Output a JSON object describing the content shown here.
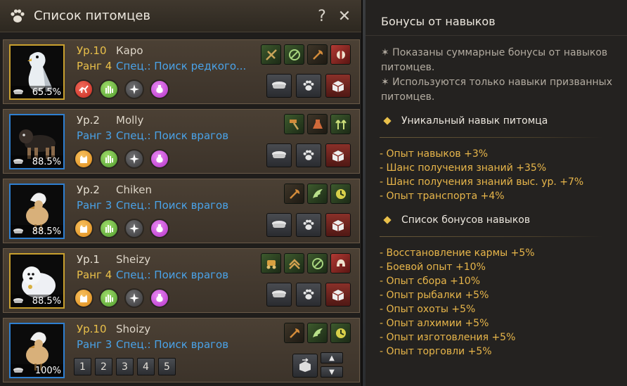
{
  "pet_window": {
    "title": "Список питомцев",
    "help_label": "?",
    "close_label": "✕",
    "pets": [
      {
        "level": "Ур.10",
        "rank": "Ранг 4",
        "name": "Каро",
        "spec": "Спец.: Поиск редкого...",
        "hunger": "65.5%",
        "rank_color": "gold",
        "frame": "gold"
      },
      {
        "level": "Ур.2",
        "rank": "Ранг 3",
        "name": "Molly",
        "spec": "Спец.: Поиск врагов",
        "hunger": "88.5%",
        "rank_color": "blue",
        "frame": "blue"
      },
      {
        "level": "Ур.2",
        "rank": "Ранг 3",
        "name": "Chiken",
        "spec": "Спец.: Поиск врагов",
        "hunger": "88.5%",
        "rank_color": "blue",
        "frame": "blue"
      },
      {
        "level": "Ур.1",
        "rank": "Ранг 4",
        "name": "Sheizy",
        "spec": "Спец.: Поиск врагов",
        "hunger": "88.5%",
        "rank_color": "gold",
        "frame": "gold"
      },
      {
        "level": "Ур.10",
        "rank": "Ранг 3",
        "name": "Shoizy",
        "spec": "Спец.: Поиск врагов",
        "hunger": "100%",
        "rank_color": "blue",
        "frame": "blue"
      }
    ],
    "pages": [
      "1",
      "2",
      "3",
      "4",
      "5"
    ],
    "page_up": "▲",
    "page_down": "▼"
  },
  "bonus_window": {
    "title": "Бонусы от навыков",
    "note1": "✶ Показаны суммарные бонусы от навыков питомцев.",
    "note2": "✶ Используются только навыки призванных питомцев.",
    "unique_title": "Уникальный навык питомца",
    "unique_items": [
      "- Опыт навыков +3%",
      "- Шанс получения знаний +35%",
      "- Шанс получения знаний выс. ур. +7%",
      "- Опыт транспорта +4%"
    ],
    "list_title": "Список бонусов навыков",
    "list_items": [
      "- Восстановление кармы +5%",
      "- Боевой опыт +10%",
      "- Опыт сбора +10%",
      "- Опыт рыбалки +5%",
      "- Опыт охоты +5%",
      "- Опыт алхимии +5%",
      "- Опыт изготовления +5%",
      "- Опыт торговли +5%"
    ]
  },
  "colors": {
    "gold": "#e9c04a",
    "blue": "#4aa3e8",
    "bonus": "#e8b64a"
  }
}
